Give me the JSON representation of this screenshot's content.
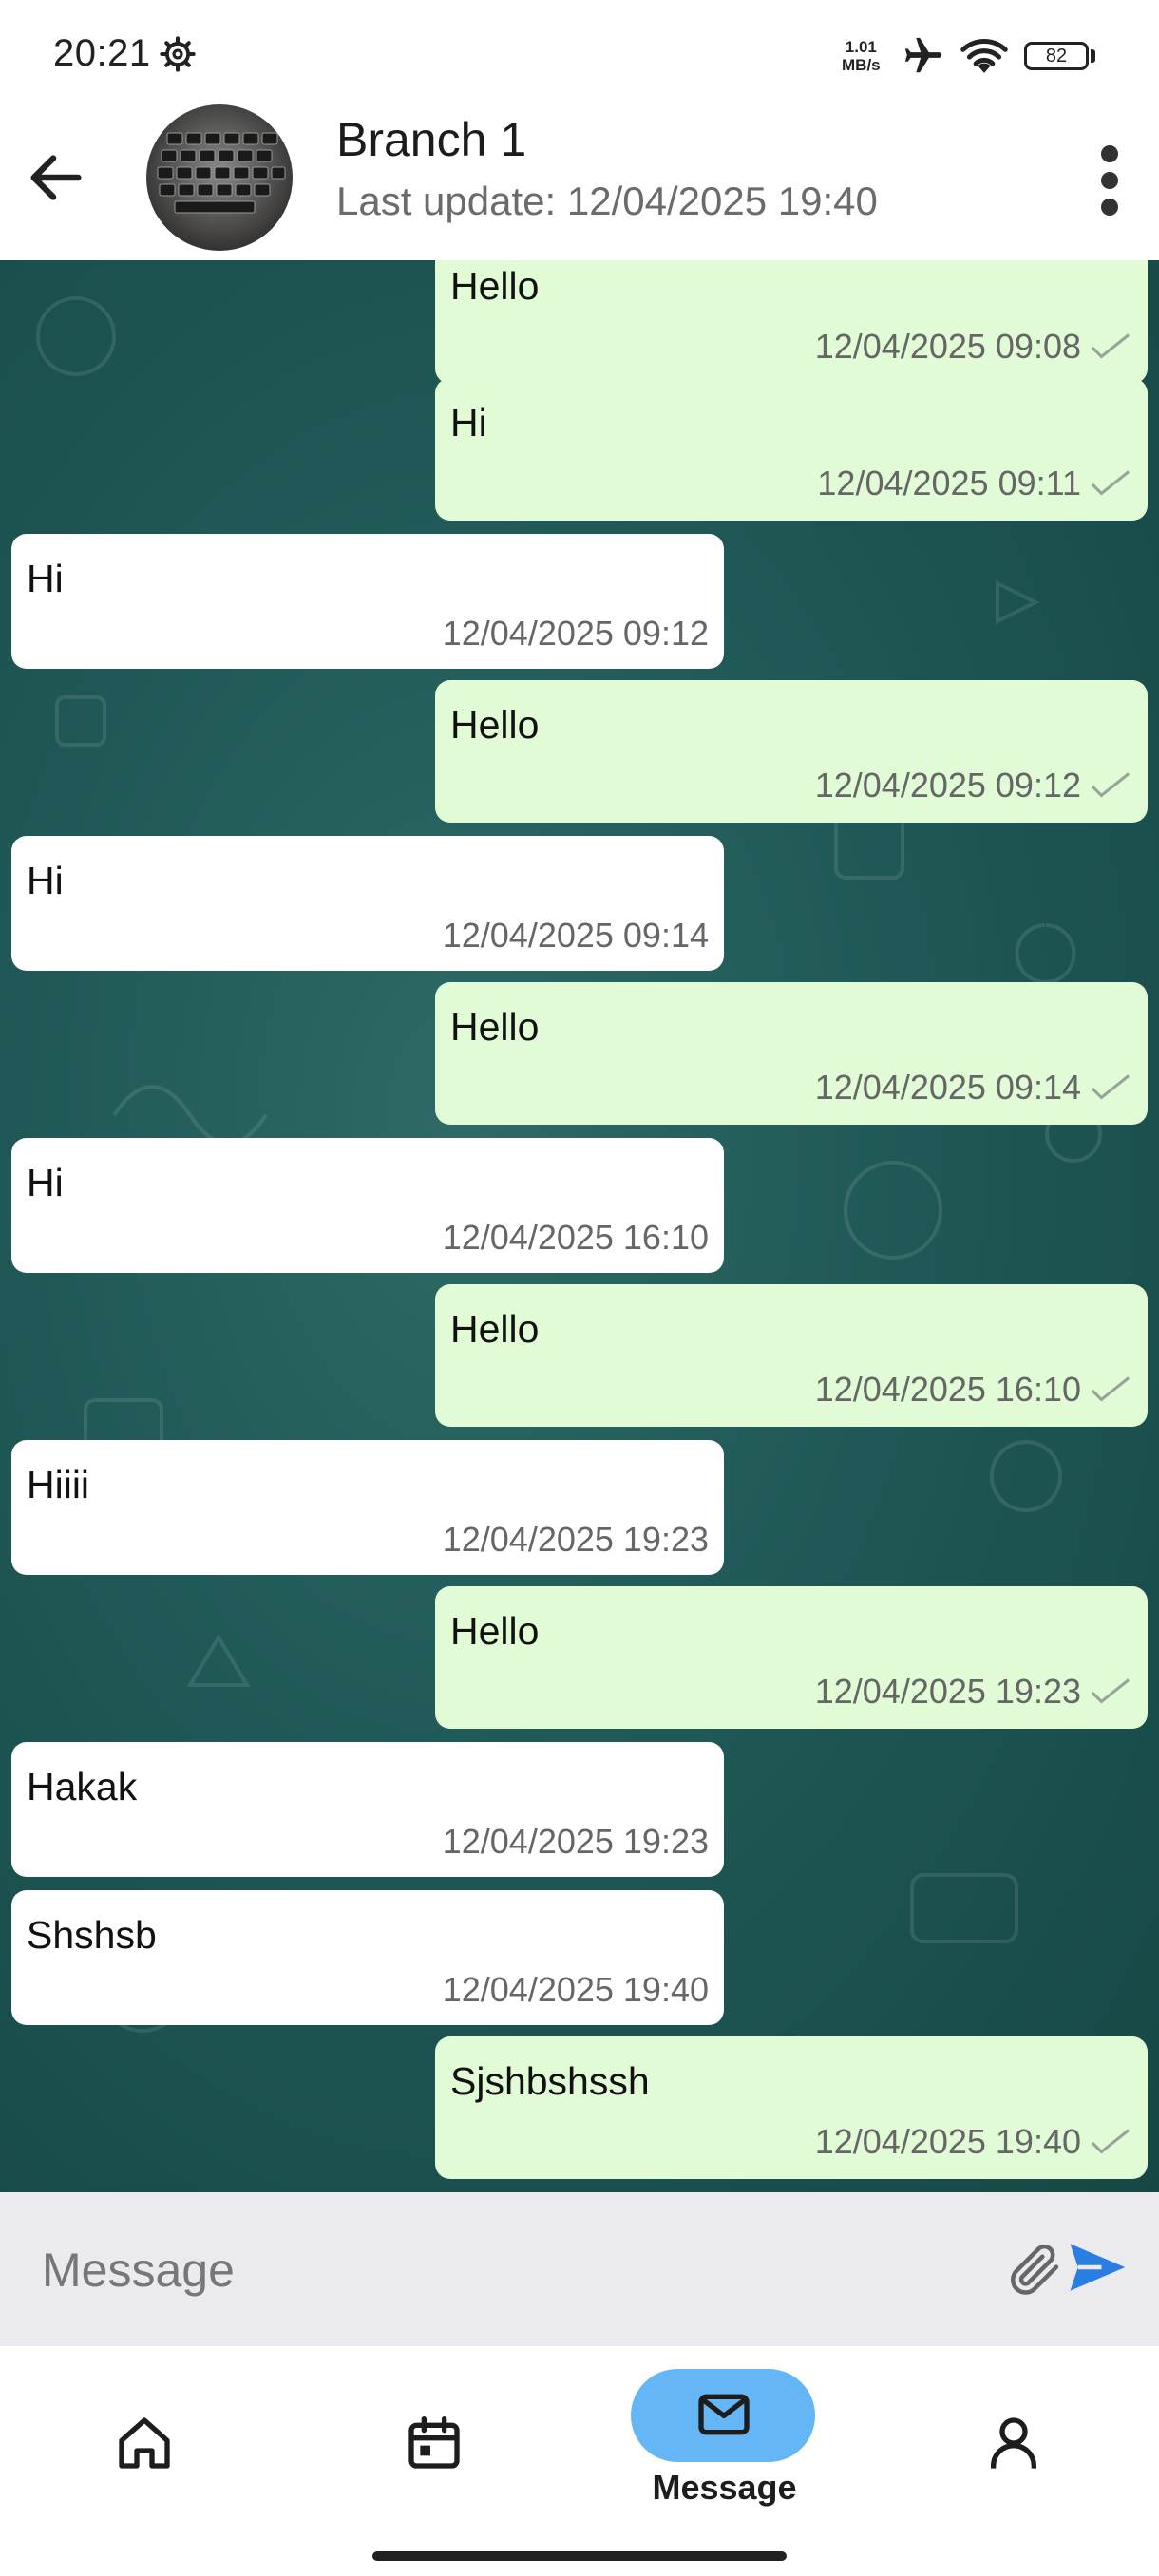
{
  "status_bar": {
    "time": "20:21",
    "speed_value": "1.01",
    "speed_unit": "MB/s",
    "battery": "82"
  },
  "header": {
    "title": "Branch 1",
    "subtitle": "Last update: 12/04/2025 19:40"
  },
  "messages": [
    {
      "dir": "out",
      "text": "Hello",
      "time": "12/04/2025 09:08"
    },
    {
      "dir": "out",
      "text": "Hi",
      "time": "12/04/2025 09:11"
    },
    {
      "dir": "in",
      "text": "Hi",
      "time": "12/04/2025 09:12"
    },
    {
      "dir": "out",
      "text": "Hello",
      "time": "12/04/2025 09:12"
    },
    {
      "dir": "in",
      "text": "Hi",
      "time": "12/04/2025 09:14"
    },
    {
      "dir": "out",
      "text": "Hello",
      "time": "12/04/2025 09:14"
    },
    {
      "dir": "in",
      "text": "Hi",
      "time": "12/04/2025 16:10"
    },
    {
      "dir": "out",
      "text": "Hello",
      "time": "12/04/2025 16:10"
    },
    {
      "dir": "in",
      "text": "Hiiii",
      "time": "12/04/2025 19:23"
    },
    {
      "dir": "out",
      "text": "Hello",
      "time": "12/04/2025 19:23"
    },
    {
      "dir": "in",
      "text": "Hakak",
      "time": "12/04/2025 19:23"
    },
    {
      "dir": "in",
      "text": "Shshsb",
      "time": "12/04/2025 19:40"
    },
    {
      "dir": "out",
      "text": "Sjshbshssh",
      "time": "12/04/2025 19:40"
    }
  ],
  "composer": {
    "placeholder": "Message",
    "value": ""
  },
  "nav": {
    "items": [
      {
        "icon": "home-icon",
        "label": ""
      },
      {
        "icon": "calendar-icon",
        "label": ""
      },
      {
        "icon": "mail-icon",
        "label": "Message",
        "active": true
      },
      {
        "icon": "person-icon",
        "label": ""
      }
    ],
    "active_color": "#64b6f7"
  },
  "colors": {
    "outgoing_bubble": "#e2fbd7",
    "incoming_bubble": "#ffffff",
    "chat_background": "#1f5856",
    "send_button": "#2a7de1"
  }
}
